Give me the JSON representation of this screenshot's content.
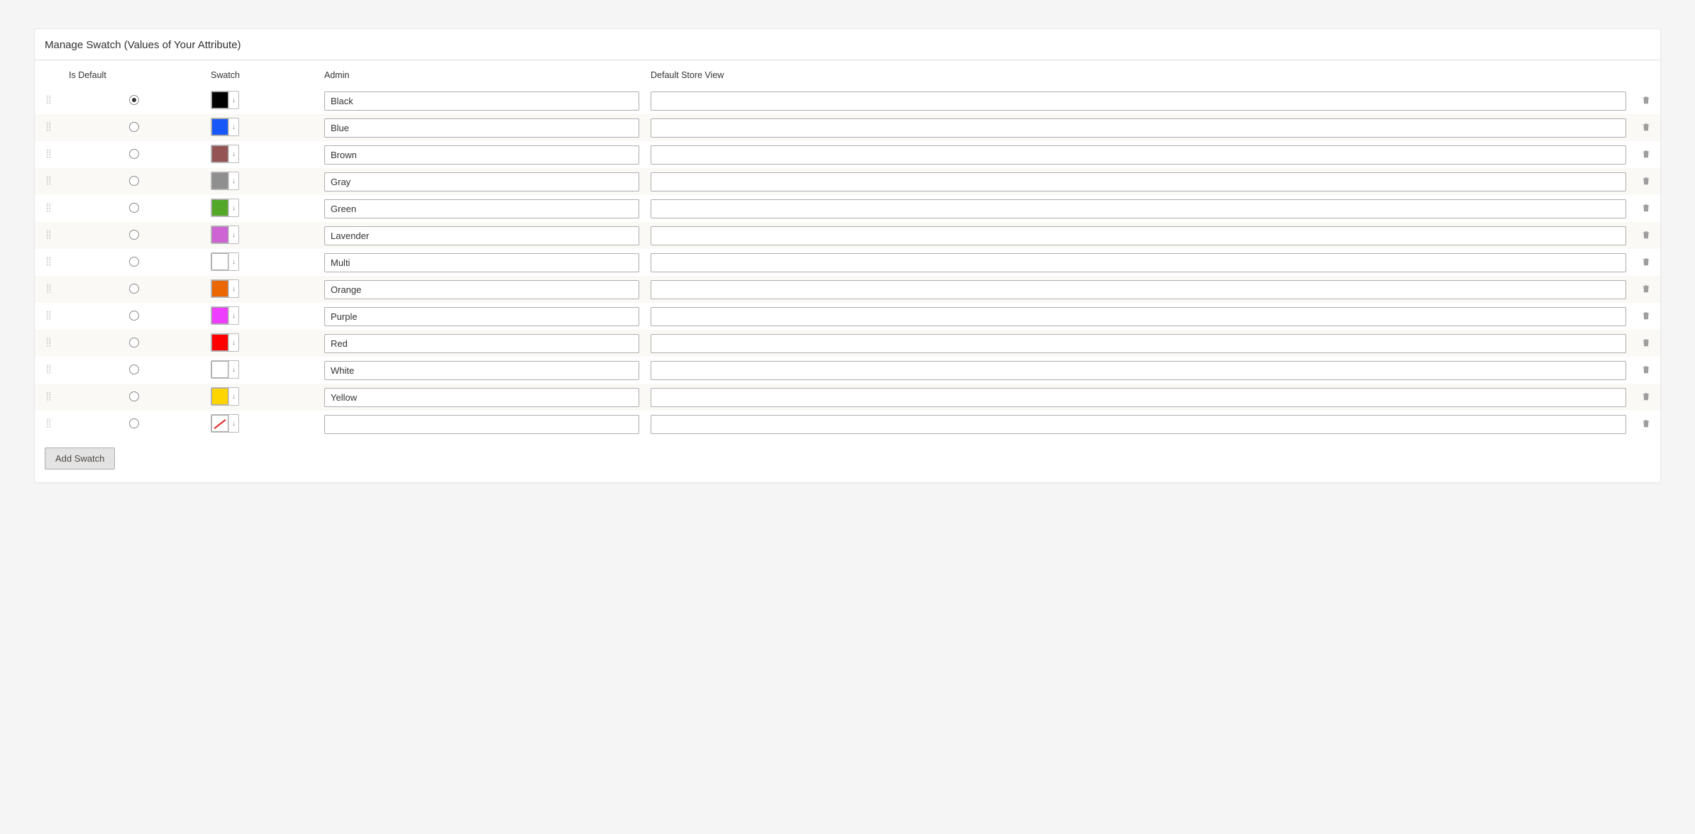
{
  "title": "Manage Swatch (Values of Your Attribute)",
  "headers": {
    "is_default": "Is Default",
    "swatch": "Swatch",
    "admin": "Admin",
    "store": "Default Store View"
  },
  "add_button": "Add Swatch",
  "rows": [
    {
      "default": true,
      "color": "#000000",
      "type": "color",
      "admin": "Black",
      "store": ""
    },
    {
      "default": false,
      "color": "#1857f7",
      "type": "color",
      "admin": "Blue",
      "store": ""
    },
    {
      "default": false,
      "color": "#945454",
      "type": "color",
      "admin": "Brown",
      "store": ""
    },
    {
      "default": false,
      "color": "#8f8f8f",
      "type": "color",
      "admin": "Gray",
      "store": ""
    },
    {
      "default": false,
      "color": "#53a828",
      "type": "color",
      "admin": "Green",
      "store": ""
    },
    {
      "default": false,
      "color": "#ce64d4",
      "type": "color",
      "admin": "Lavender",
      "store": ""
    },
    {
      "default": false,
      "color": "",
      "type": "empty",
      "admin": "Multi",
      "store": ""
    },
    {
      "default": false,
      "color": "#eb6703",
      "type": "color",
      "admin": "Orange",
      "store": ""
    },
    {
      "default": false,
      "color": "#ef3dff",
      "type": "color",
      "admin": "Purple",
      "store": ""
    },
    {
      "default": false,
      "color": "#ff0000",
      "type": "color",
      "admin": "Red",
      "store": ""
    },
    {
      "default": false,
      "color": "",
      "type": "empty",
      "admin": "White",
      "store": ""
    },
    {
      "default": false,
      "color": "#ffd500",
      "type": "color",
      "admin": "Yellow",
      "store": ""
    },
    {
      "default": false,
      "color": "",
      "type": "cleared",
      "admin": "",
      "store": ""
    }
  ]
}
